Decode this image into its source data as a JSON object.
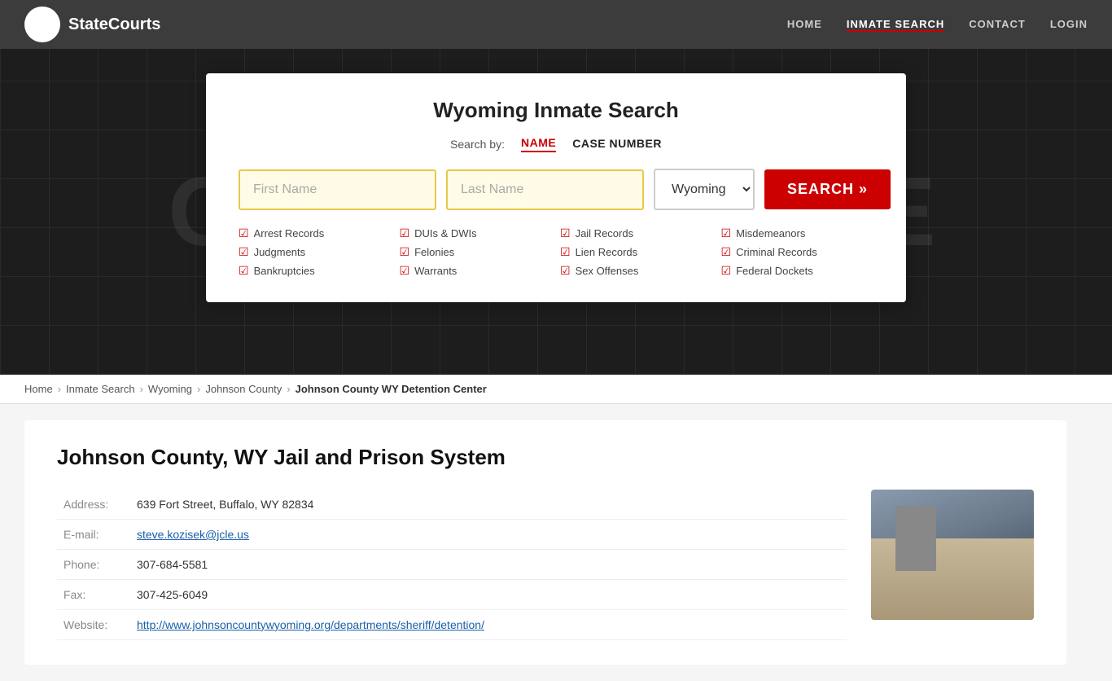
{
  "nav": {
    "logo_text": "StateCourts",
    "logo_icon": "🏛",
    "links": [
      {
        "label": "HOME",
        "href": "#",
        "active": false
      },
      {
        "label": "INMATE SEARCH",
        "href": "#",
        "active": true
      },
      {
        "label": "CONTACT",
        "href": "#",
        "active": false
      },
      {
        "label": "LOGIN",
        "href": "#",
        "active": false
      }
    ]
  },
  "search_card": {
    "title": "Wyoming Inmate Search",
    "search_by_label": "Search by:",
    "tabs": [
      {
        "label": "NAME",
        "active": true
      },
      {
        "label": "CASE NUMBER",
        "active": false
      }
    ],
    "first_name_placeholder": "First Name",
    "last_name_placeholder": "Last Name",
    "state_value": "Wyoming",
    "search_btn_label": "SEARCH »",
    "features": [
      "Arrest Records",
      "DUIs & DWIs",
      "Jail Records",
      "Misdemeanors",
      "Judgments",
      "Felonies",
      "Lien Records",
      "Criminal Records",
      "Bankruptcies",
      "Warrants",
      "Sex Offenses",
      "Federal Dockets"
    ]
  },
  "breadcrumb": {
    "items": [
      {
        "label": "Home",
        "href": "#"
      },
      {
        "label": "Inmate Search",
        "href": "#"
      },
      {
        "label": "Wyoming",
        "href": "#"
      },
      {
        "label": "Johnson County",
        "href": "#"
      },
      {
        "label": "Johnson County WY Detention Center",
        "current": true
      }
    ]
  },
  "facility": {
    "title": "Johnson County, WY Jail and Prison System",
    "address_label": "Address:",
    "address_value": "639 Fort Street, Buffalo, WY 82834",
    "email_label": "E-mail:",
    "email_value": "steve.kozisek@jcle.us",
    "phone_label": "Phone:",
    "phone_value": "307-684-5581",
    "fax_label": "Fax:",
    "fax_value": "307-425-6049",
    "website_label": "Website:",
    "website_value": "http://www.johnsoncountywyoming.org/departments/sheriff/detention/"
  }
}
